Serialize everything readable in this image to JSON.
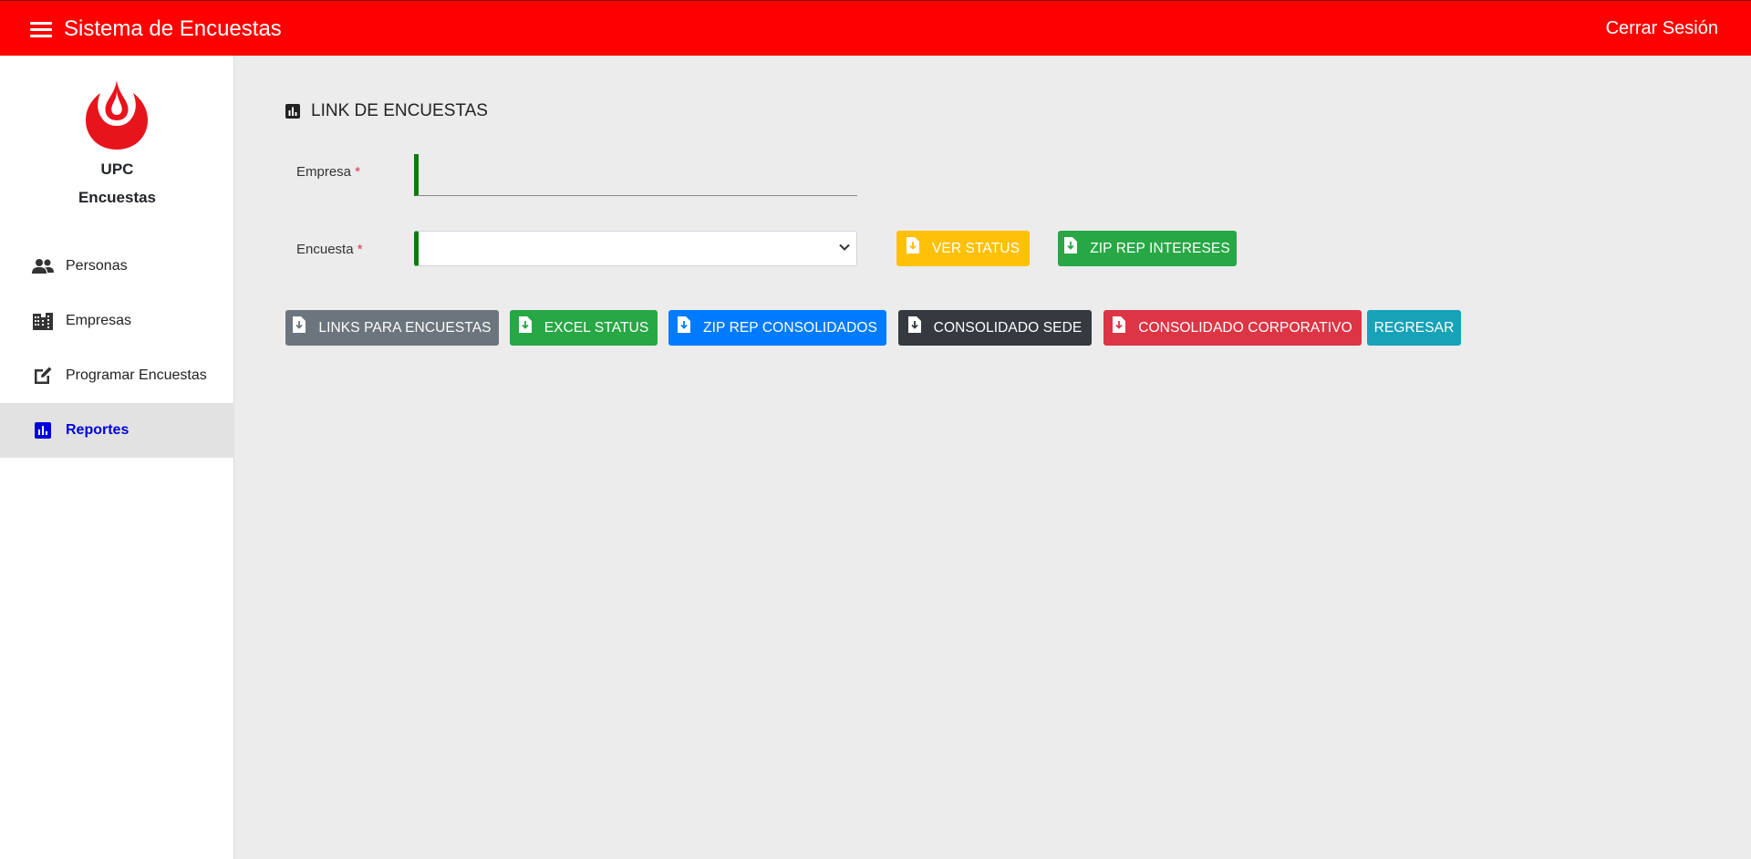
{
  "header": {
    "title": "Sistema de Encuestas",
    "logout_label": "Cerrar Sesión",
    "bg_color": "#ff0000"
  },
  "sidebar": {
    "brand_line1": "UPC",
    "brand_line2": "Encuestas",
    "items": [
      {
        "label": "Personas",
        "icon": "people-icon",
        "active": false
      },
      {
        "label": "Empresas",
        "icon": "buildings-icon",
        "active": false
      },
      {
        "label": "Programar Encuestas",
        "icon": "edit-icon",
        "active": false
      },
      {
        "label": "Reportes",
        "icon": "bar-chart-icon",
        "active": true
      }
    ]
  },
  "main": {
    "section_title": "LINK DE ENCUESTAS",
    "empresa_label": "Empresa",
    "encuesta_label": "Encuesta",
    "required_marker": "*",
    "empresa_value": "",
    "encuesta_value": "",
    "buttons_row1": [
      {
        "label": "VER STATUS",
        "color": "#ffc107",
        "icon": "file-download-icon"
      },
      {
        "label": "ZIP REP INTERESES",
        "color": "#28a745",
        "icon": "file-download-icon"
      }
    ],
    "buttons_row2": [
      {
        "label": "LINKS PARA ENCUESTAS",
        "color": "#6c757d",
        "icon": "file-download-icon"
      },
      {
        "label": "EXCEL STATUS",
        "color": "#28a745",
        "icon": "file-download-icon"
      },
      {
        "label": "ZIP REP CONSOLIDADOS",
        "color": "#007bff",
        "icon": "file-download-icon"
      },
      {
        "label": "CONSOLIDADO SEDE",
        "color": "#343a40",
        "icon": "file-download-icon"
      },
      {
        "label": "CONSOLIDADO CORPORATIVO",
        "color": "#dc3545",
        "icon": "file-download-icon"
      },
      {
        "label": "REGRESAR",
        "color": "#17a2b8",
        "icon": ""
      }
    ]
  }
}
